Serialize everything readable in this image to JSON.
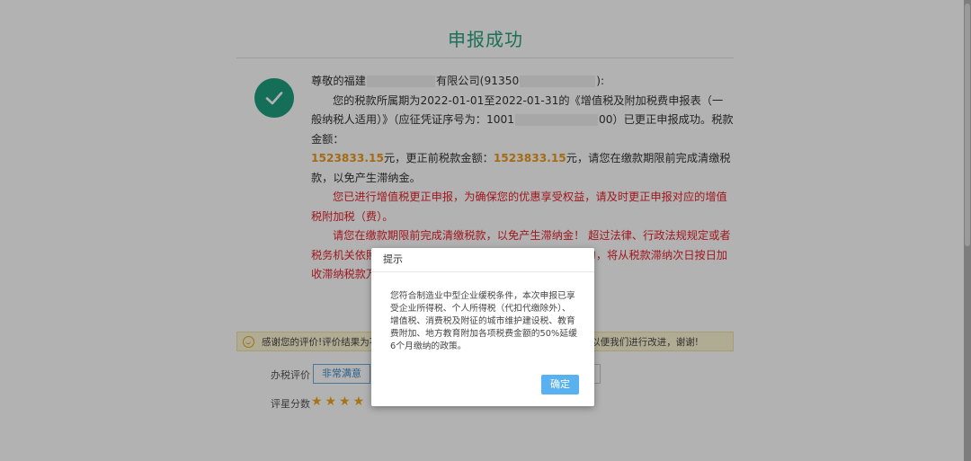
{
  "page_title": "申报成功",
  "message": {
    "greeting_a": "尊敬的福建",
    "greeting_b": "有限公司(91350",
    "greeting_c": "):",
    "p1_a": "您的税款所属期为2022-01-01至2022-01-31的《增值税及附加税费申报表（一般纳税人适用）》（应征凭证序号为：1001",
    "p1_b": "00）已更正申报成功。税款金额：",
    "amount": "1523833.15",
    "p1_c": "元，更正前税款金额：",
    "amount_before": "1523833.15",
    "p1_d": "元，请您在缴款期限前完成清缴税款，以免产生滞纳金。",
    "warning1": "您已进行增值税更正申报，为确保您的优惠享受权益，请及时更正申报对应的增值税附加税（费）。",
    "warning2": "请您在缴款期限前完成清缴税款，以免产生滞纳金！ 超过法律、行政法规规定或者税务机关依照法律、行政法规的规定确定的缴纳期限缴款的，将从税款滞纳次日按日加收滞纳税款万分之五的滞纳金。"
  },
  "feedback": {
    "notice_text": "感谢您的评价!评价结果为不满",
    "notice_tail": "，以便我们进行改进，谢谢!",
    "eval_label": "办税评价",
    "eval_button": "非常满意",
    "score_label": "评星分数",
    "stars": "★★★★"
  },
  "dialog": {
    "title": "提示",
    "body": "您符合制造业中型企业缓税条件，本次申报已享受企业所得税、个人所得税（代扣代缴除外）、增值税、消费税及附征的城市维护建设税、教育费附加、地方教育附加各项税费金额的50%延缓6个月缴纳的政策。",
    "ok_button": "确定"
  },
  "colors": {
    "title_green": "#29a17a",
    "amount_orange": "#ec9a1c",
    "warning_red": "#e5222b",
    "button_blue": "#5ab1ef"
  },
  "icons": {
    "success": "check-circle-icon",
    "notice": "smile-icon",
    "star": "star-icon"
  }
}
